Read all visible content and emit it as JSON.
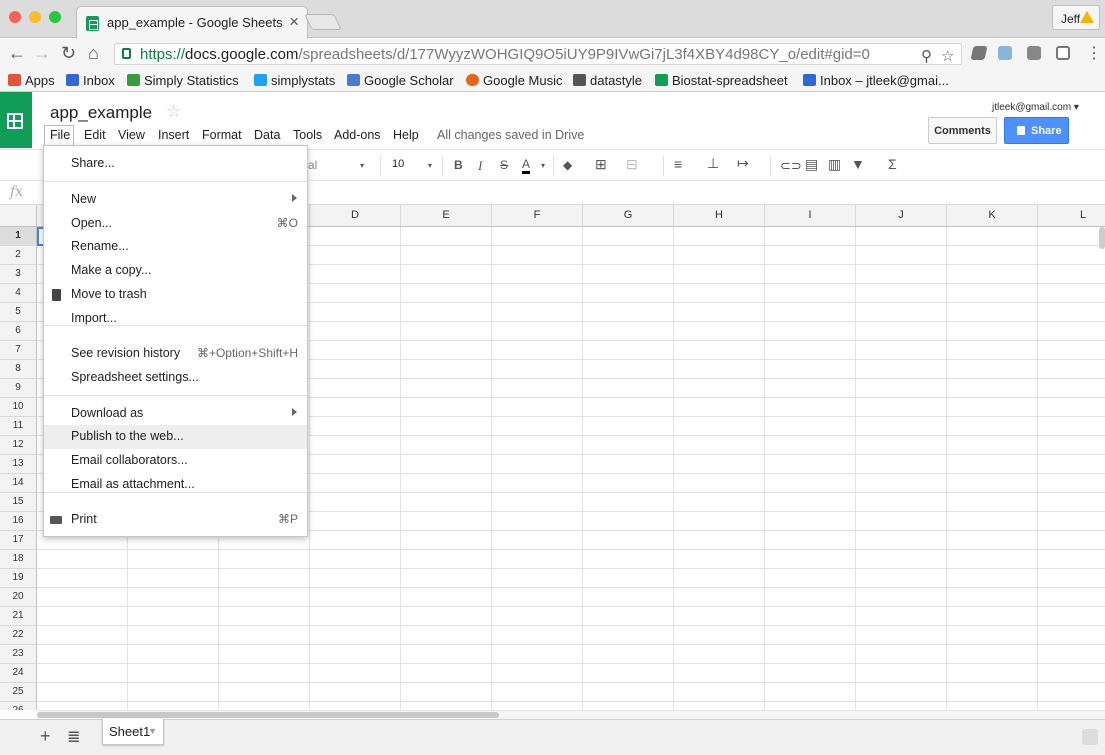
{
  "browser": {
    "tab_title": "app_example - Google Sheets",
    "tab_close": "×",
    "profile_name": "Jeff",
    "url_protocol": "https://",
    "url_host": "docs.google.com",
    "url_path": "/spreadsheets/d/177WyyzWOHGIQ9O5iUY9P9IVwGi7jL3f4XBY4d98CY_o/edit#gid=0",
    "bookmarks": [
      "Apps",
      "Inbox",
      "Simply Statistics",
      "simplystats",
      "Google Scholar",
      "Google Music",
      "datastyle",
      "Biostat-spreadsheet",
      "Inbox – jtleek@gmai..."
    ],
    "bookmark_colors": [
      "#e0533d",
      "#2f68d6",
      "#3a9b3a",
      "#1da1f2",
      "#4a7bd0",
      "#e8641b",
      "#555555",
      "#0f9d58",
      "#2f68d6"
    ]
  },
  "sheets": {
    "doc_title": "app_example",
    "star": "☆",
    "account": "jtleek@gmail.com ▾",
    "comments_label": "Comments",
    "share_label": "Share",
    "menu": [
      "File",
      "Edit",
      "View",
      "Insert",
      "Format",
      "Data",
      "Tools",
      "Add-ons",
      "Help"
    ],
    "save_status": "All changes saved in Drive",
    "font_name": "al",
    "font_size": "10",
    "fx": "fx"
  },
  "grid": {
    "columns": [
      "D",
      "E",
      "F",
      "G",
      "H",
      "I",
      "J",
      "K",
      "L"
    ],
    "rows": [
      "1",
      "2",
      "3",
      "4",
      "5",
      "6",
      "7",
      "8",
      "9",
      "10",
      "11",
      "12",
      "13",
      "14",
      "15",
      "16",
      "17",
      "18",
      "19",
      "20",
      "21",
      "22",
      "23",
      "24",
      "25",
      "26"
    ],
    "selected_cell": "A1"
  },
  "sheet_tabs": [
    "Sheet1"
  ],
  "file_menu": {
    "items": [
      {
        "label": "Share...",
        "shortcut": ""
      },
      {
        "label": "New",
        "shortcut": "",
        "submenu": true
      },
      {
        "label": "Open...",
        "shortcut": "⌘O"
      },
      {
        "label": "Rename...",
        "shortcut": ""
      },
      {
        "label": "Make a copy...",
        "shortcut": ""
      },
      {
        "label": "Move to trash",
        "shortcut": "",
        "icon": "trash-icon"
      },
      {
        "label": "Import...",
        "shortcut": ""
      },
      {
        "label": "See revision history",
        "shortcut": "⌘+Option+Shift+H"
      },
      {
        "label": "Spreadsheet settings...",
        "shortcut": ""
      },
      {
        "label": "Download as",
        "shortcut": "",
        "submenu": true
      },
      {
        "label": "Publish to the web...",
        "shortcut": "",
        "highlighted": true
      },
      {
        "label": "Email collaborators...",
        "shortcut": ""
      },
      {
        "label": "Email as attachment...",
        "shortcut": ""
      },
      {
        "label": "Print",
        "shortcut": "⌘P",
        "icon": "printer-icon"
      }
    ]
  },
  "colors": {
    "sheets_green": "#0f9d58",
    "share_blue": "#4d90fe",
    "selection_blue": "#4285f4"
  }
}
